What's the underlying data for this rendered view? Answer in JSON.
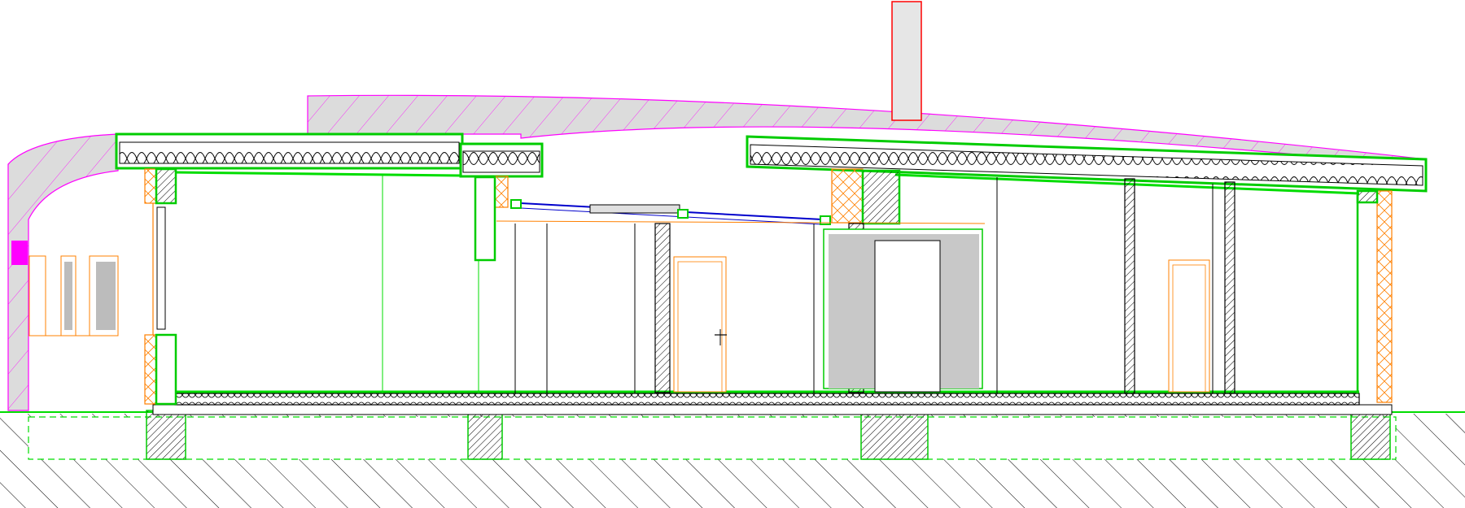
{
  "drawing": {
    "kind": "architectural building section",
    "colors": {
      "roof_cladding": "#ff00ff",
      "structure": "#00cc00",
      "timber_insulation": "#ff8000",
      "glazing": "#0000cc",
      "chimney": "#ff0000",
      "fill_grey": "#d8d8d8",
      "linework": "#000000"
    },
    "elements": [
      "ground-line",
      "earth-hatch",
      "foundation-footings",
      "floor-slab",
      "curved-roof-shell",
      "roof-slab-left",
      "roof-slab-right",
      "roof-insulation",
      "chimney",
      "skylight",
      "columns",
      "interior-doors",
      "exterior-walls",
      "left-wing-windows"
    ]
  }
}
